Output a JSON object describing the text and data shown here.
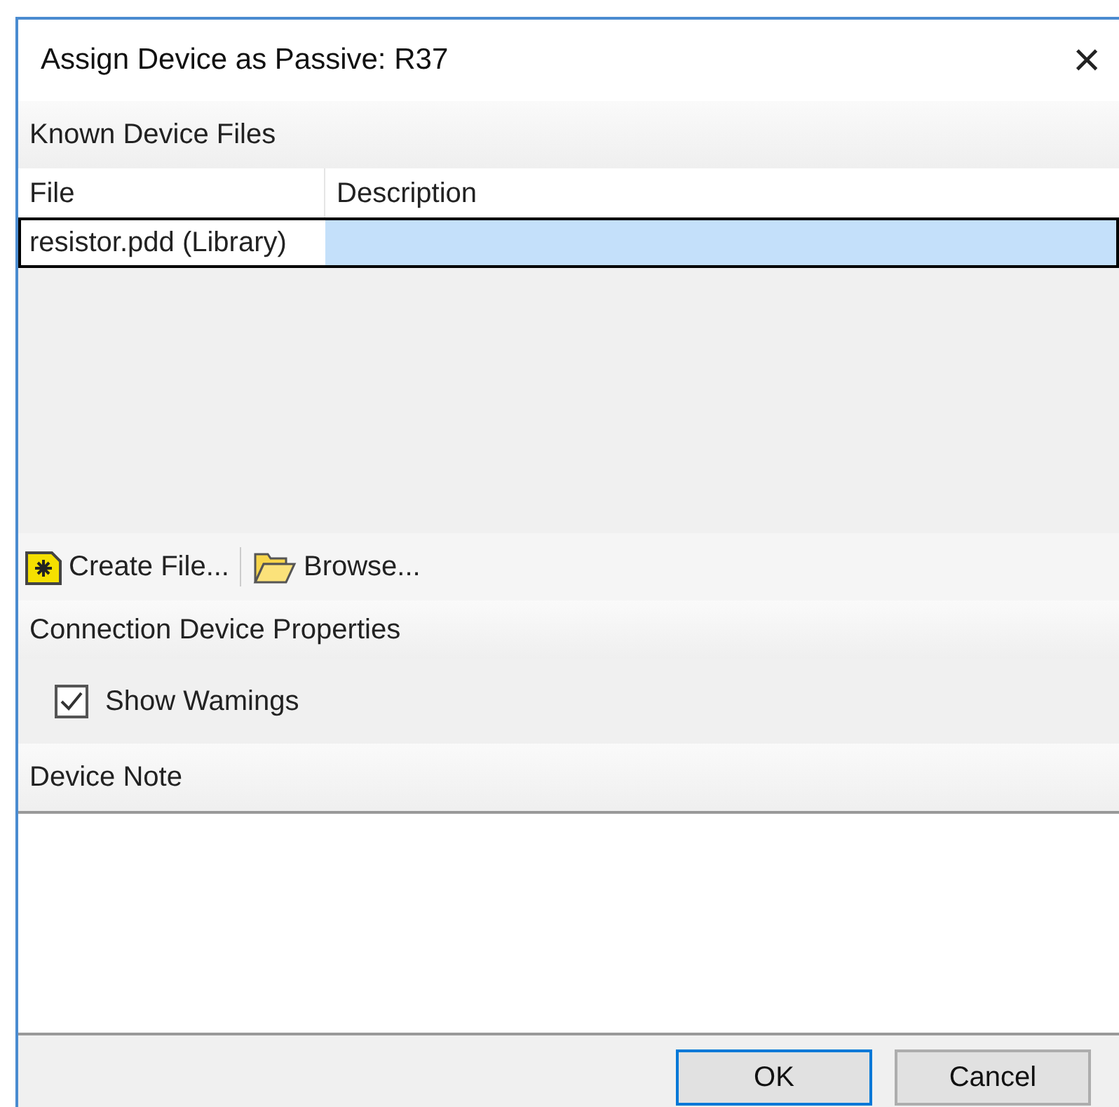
{
  "window": {
    "title": "Assign Device as Passive: R37",
    "close_label": "×"
  },
  "known_files": {
    "header": "Known Device Files",
    "columns": [
      "File",
      "Description"
    ],
    "rows": [
      {
        "cells": [
          "resistor.pdd (Library)",
          ""
        ],
        "selected": true
      }
    ]
  },
  "toolbar": [
    {
      "label": "Create File...",
      "kind": "create"
    },
    {
      "label": "Browse...",
      "kind": "browse"
    }
  ],
  "connection": {
    "header": "Connection Device Properties",
    "show_warnings": {
      "label": "Show Wamings",
      "checked": true
    }
  },
  "note": {
    "header": "Device Note"
  },
  "buttons": [
    {
      "label": "OK",
      "default": true
    },
    {
      "label": "Cancel",
      "default": false
    }
  ]
}
